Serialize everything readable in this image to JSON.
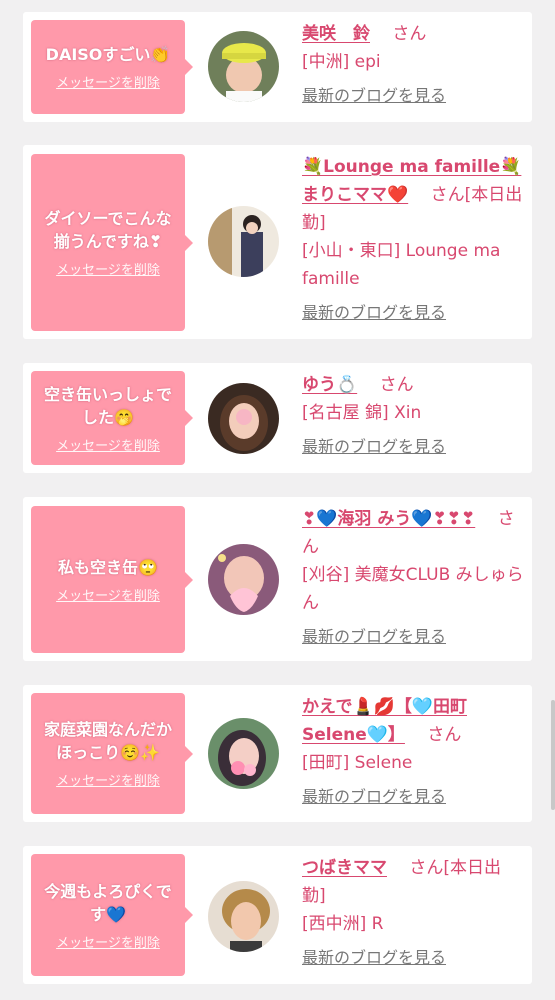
{
  "colors": {
    "accent": "#d8486f",
    "bubble": "#ff99aa",
    "link_gray": "#777777",
    "bg": "#f1f0f1"
  },
  "cards": [
    {
      "message": "DAISOすごい👏",
      "delete_label": "メッセージを削除",
      "name": "美咲　鈴",
      "honorific": "さん",
      "status": "",
      "shop": "[中洲] epi",
      "blog_link": "最新のブログを見る",
      "avatar_icon": "avatar-photo-icon"
    },
    {
      "message": "ダイソーでこんな揃うんですね❣",
      "delete_label": "メッセージを削除",
      "name": "💐Lounge ma famille💐まりこママ❤️",
      "honorific": "さん",
      "status": "[本日出勤]",
      "shop": "[小山・東口] Lounge ma famille",
      "blog_link": "最新のブログを見る",
      "avatar_icon": "avatar-photo-icon"
    },
    {
      "message": "空き缶いっしょでした🤭",
      "delete_label": "メッセージを削除",
      "name": "ゆう💍",
      "honorific": "さん",
      "status": "",
      "shop": "[名古屋 錦] Xin",
      "blog_link": "最新のブログを見る",
      "avatar_icon": "avatar-photo-icon"
    },
    {
      "message": "私も空き缶🙄",
      "delete_label": "メッセージを削除",
      "name": "❣💙海羽 みう💙❣❣❣",
      "honorific": "さん",
      "status": "",
      "shop": "[刈谷] 美魔女CLUB みしゅらん",
      "blog_link": "最新のブログを見る",
      "avatar_icon": "avatar-photo-icon"
    },
    {
      "message": "家庭菜園なんだかほっこり☺️✨",
      "delete_label": "メッセージを削除",
      "name": "かえで💄💋【🩵田町Selene🩵】",
      "honorific": "さん",
      "status": "",
      "shop": "[田町] Selene",
      "blog_link": "最新のブログを見る",
      "avatar_icon": "avatar-photo-icon"
    },
    {
      "message": "今週もよろぴくです💙",
      "delete_label": "メッセージを削除",
      "name": "つばきママ",
      "honorific": "さん",
      "status": "[本日出勤]",
      "shop": "[西中洲] R",
      "blog_link": "最新のブログを見る",
      "avatar_icon": "avatar-photo-icon"
    }
  ]
}
